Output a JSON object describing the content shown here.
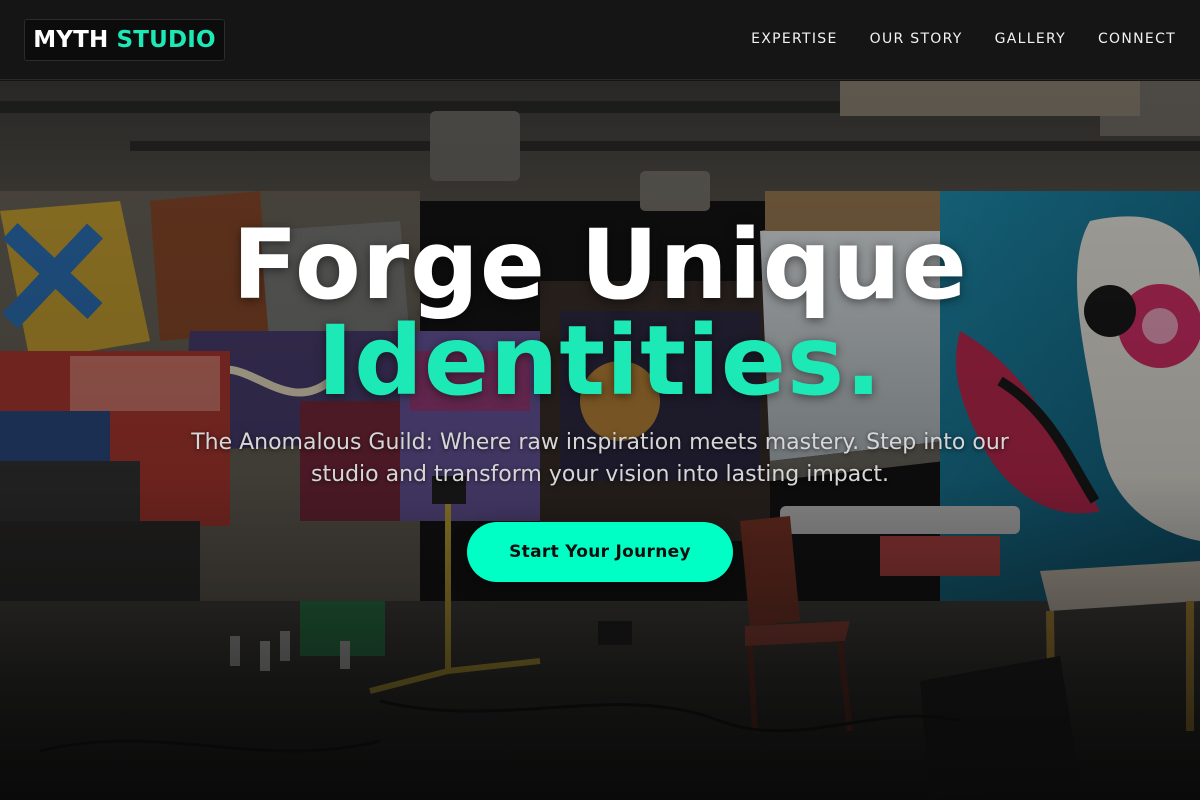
{
  "brand": {
    "word1": "MYTH",
    "word2": "STUDIO"
  },
  "nav": {
    "items": [
      {
        "label": "EXPERTISE"
      },
      {
        "label": "OUR STORY"
      },
      {
        "label": "GALLERY"
      },
      {
        "label": "CONNECT"
      }
    ]
  },
  "hero": {
    "headline_line1": "Forge Unique",
    "headline_line2": "Identities.",
    "subtitle": "The Anomalous Guild: Where raw inspiration meets mastery. Step into our studio and transform your vision into lasting impact.",
    "cta_label": "Start Your Journey",
    "background_image": "graffiti-art-studio-photo"
  },
  "colors": {
    "accent": "#1de9b6",
    "button": "#00ffc4",
    "nav_background": "#151515",
    "text": "#ffffff"
  }
}
